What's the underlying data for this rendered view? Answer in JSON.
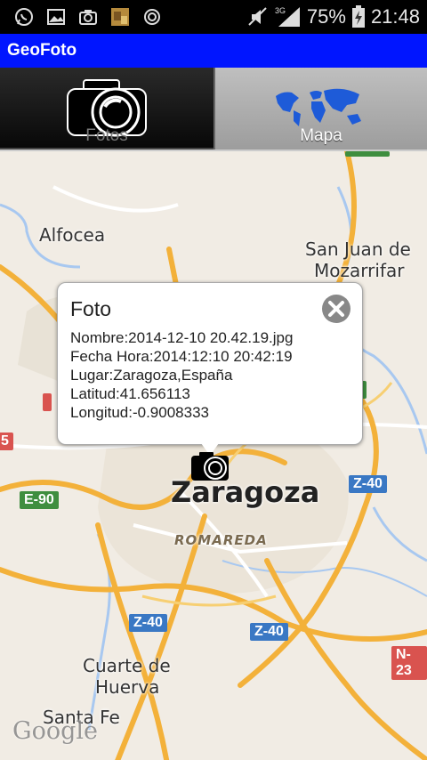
{
  "statusbar": {
    "battery": "75%",
    "time": "21:48",
    "network": "3G",
    "icons": [
      "whatsapp-icon",
      "gallery-icon",
      "camera-icon",
      "photo-thumb-icon",
      "sync-icon",
      "mute-icon",
      "signal-icon",
      "battery-icon"
    ]
  },
  "app": {
    "title": "GeoFoto"
  },
  "tabs": [
    {
      "label": "Fotos",
      "icon": "camera-icon",
      "selected": false
    },
    {
      "label": "Mapa",
      "icon": "world-map-icon",
      "selected": true
    }
  ],
  "popup": {
    "title": "Foto",
    "lines": [
      "Nombre:2014-12-10 20.42.19.jpg",
      "Fecha Hora:2014:12:10 20:42:19",
      "Lugar:Zaragoza,España",
      "Latitud:41.656113",
      "Longitud:-0.9008333"
    ]
  },
  "map": {
    "places": [
      "Alfocea",
      "San Juan de",
      "Mozarrifar",
      "Zaragoza",
      "ROMAREDA",
      "Cuarte de",
      "Huerva",
      "Santa Fe"
    ],
    "roads": [
      "Z-40",
      "Z-40",
      "Z-40",
      "E-90",
      "N-23"
    ],
    "edge_fragments": [
      "5"
    ],
    "attribution": "Google"
  },
  "colors": {
    "title_bar": "#0015ff",
    "road": "#f3b13a",
    "water": "#a8c8f0"
  }
}
